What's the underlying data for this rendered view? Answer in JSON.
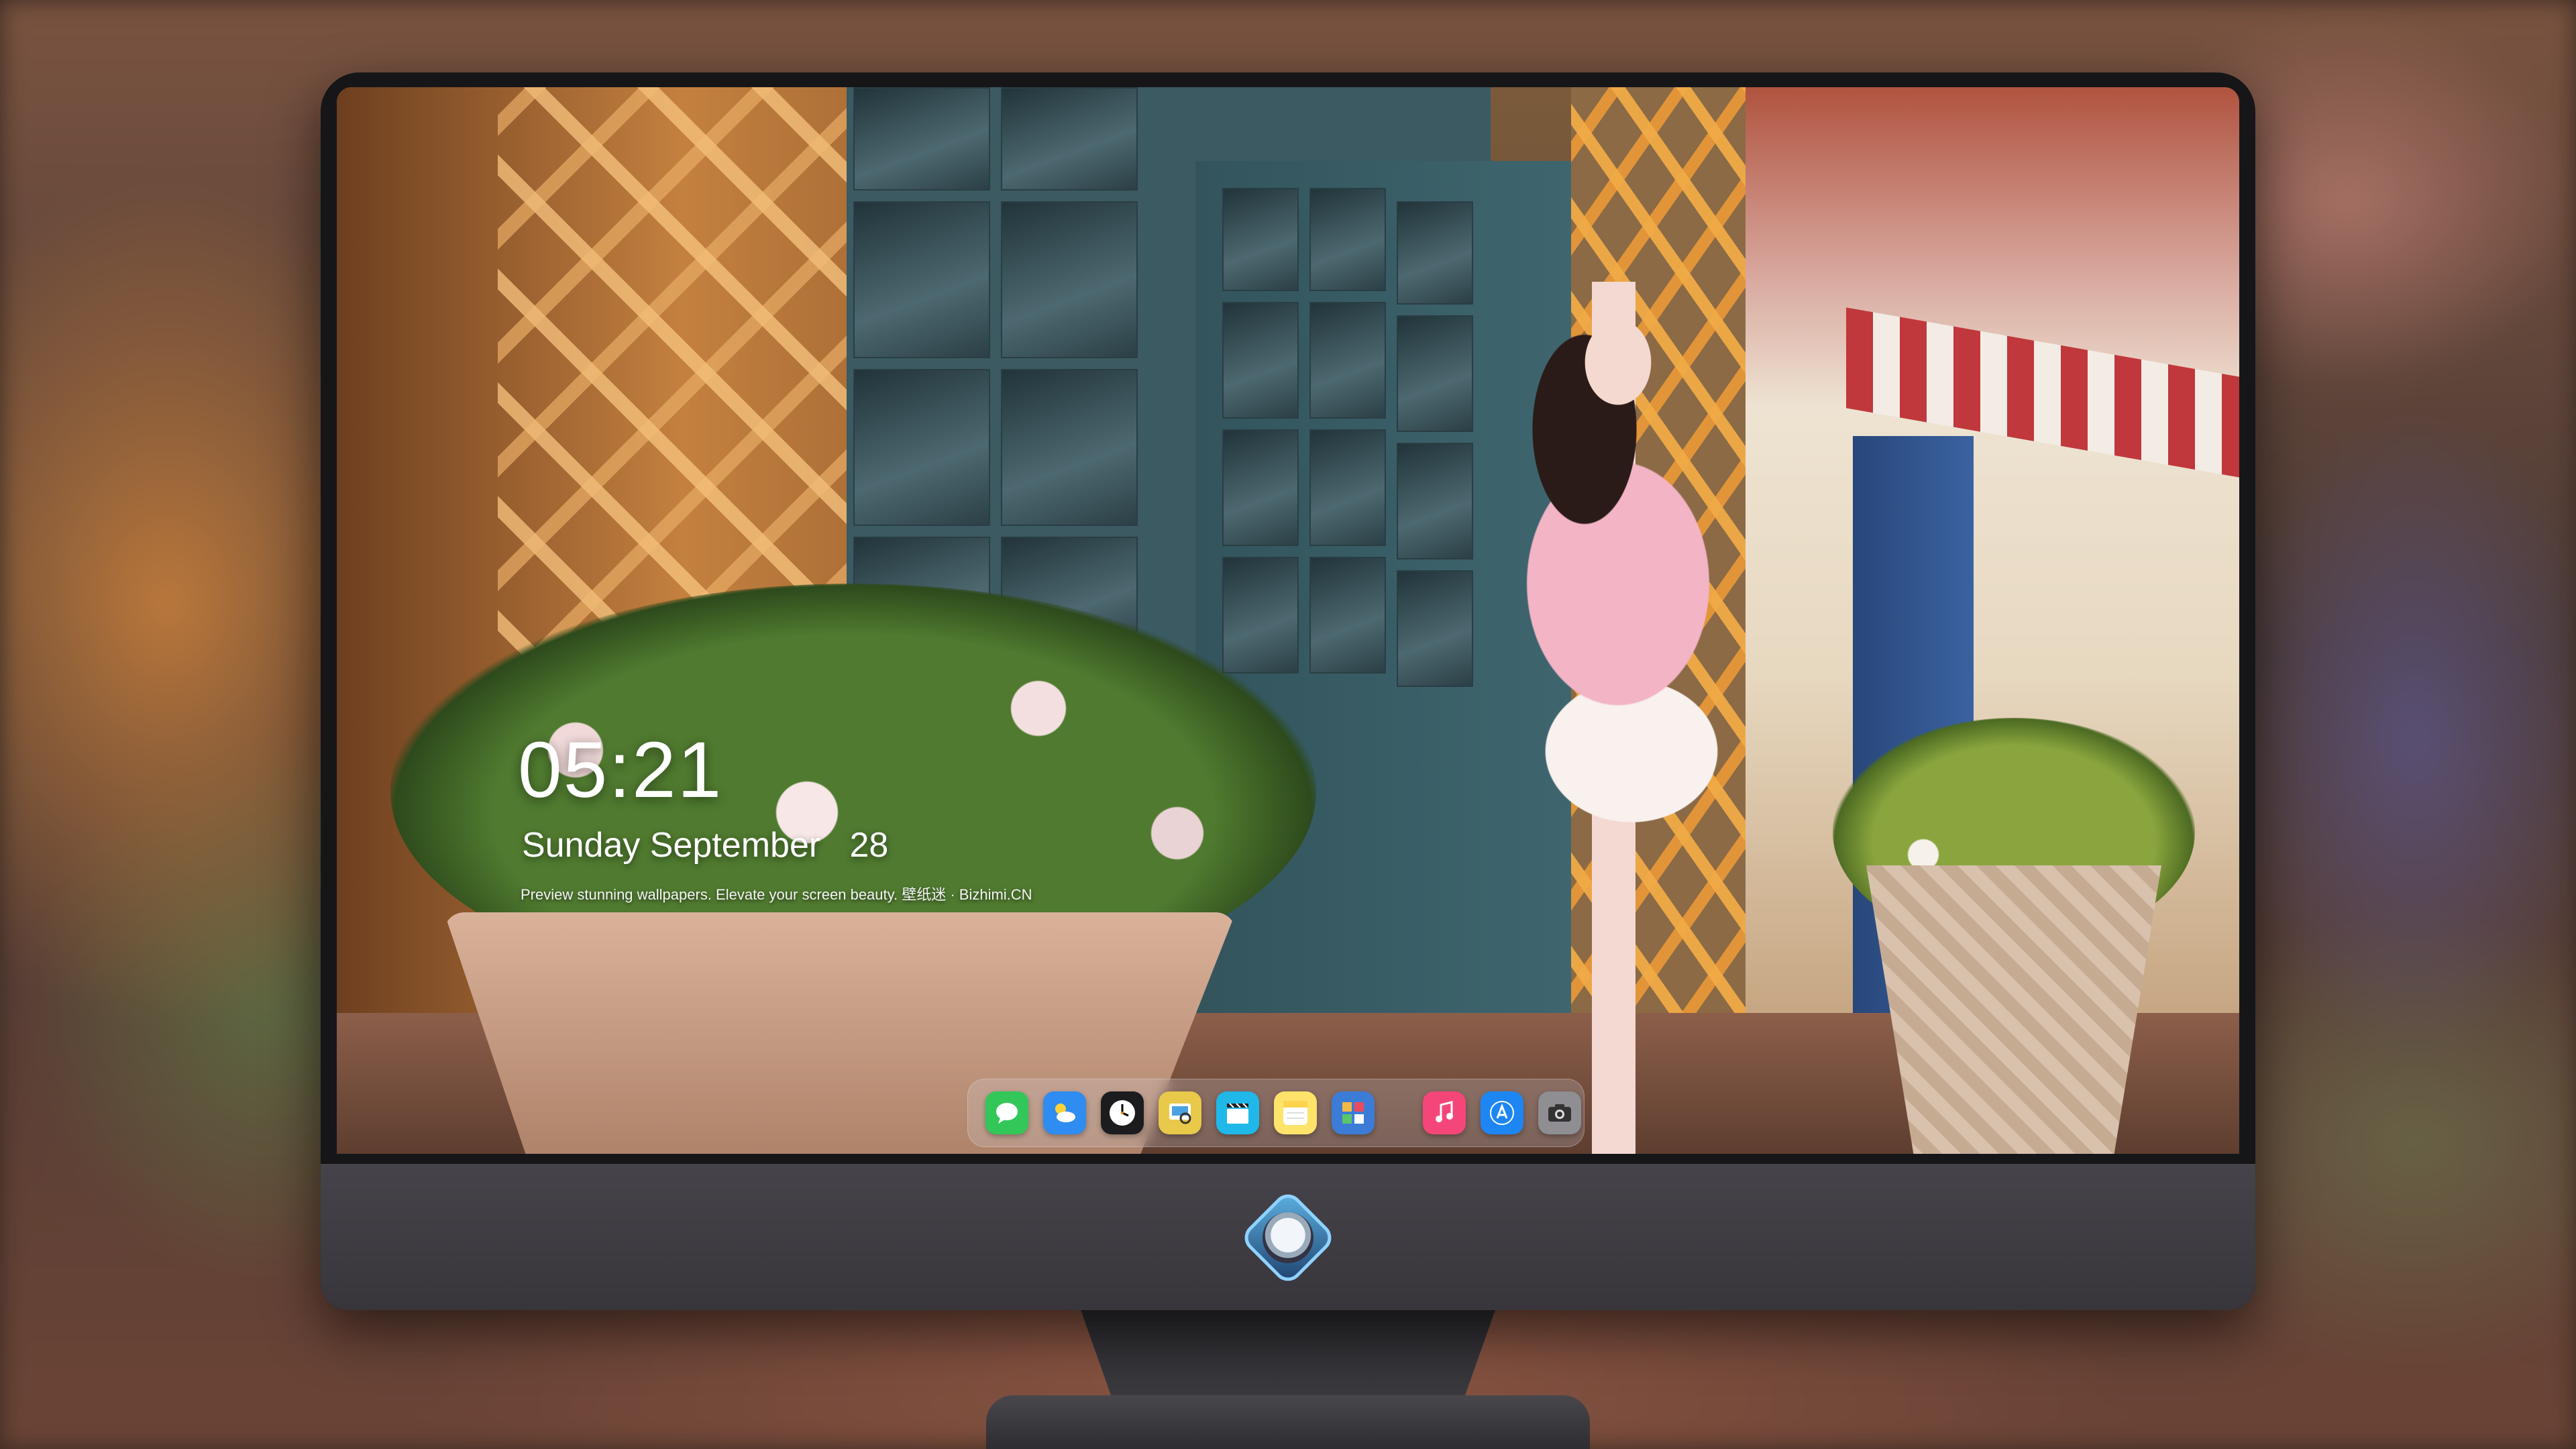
{
  "lock_screen": {
    "time": "05:21",
    "date": "Sunday September   28",
    "tagline": "Preview stunning wallpapers. Elevate your screen beauty. 壁纸迷 · Bizhimi.CN"
  },
  "dock": {
    "apps": [
      {
        "name": "messages-icon",
        "color": "#33c759"
      },
      {
        "name": "weather-icon",
        "color": "#2f8cf0"
      },
      {
        "name": "clock-icon",
        "color": "#1c1c1e"
      },
      {
        "name": "preview-icon",
        "color": "#e8c94a"
      },
      {
        "name": "clips-icon",
        "color": "#1fb8e8"
      },
      {
        "name": "notes-icon",
        "color": "#fde36a"
      },
      {
        "name": "photo-booth-icon",
        "color": "#3d7cd6"
      },
      {
        "name": "music-icon",
        "color": "#f5467a"
      },
      {
        "name": "app-store-icon",
        "color": "#1e86f3"
      },
      {
        "name": "camera-icon",
        "color": "#8e8e93"
      }
    ]
  },
  "colors": {
    "bezel": "#161619",
    "chin": "#403d43",
    "dock_glass": "rgba(220,225,235,0.22)"
  }
}
